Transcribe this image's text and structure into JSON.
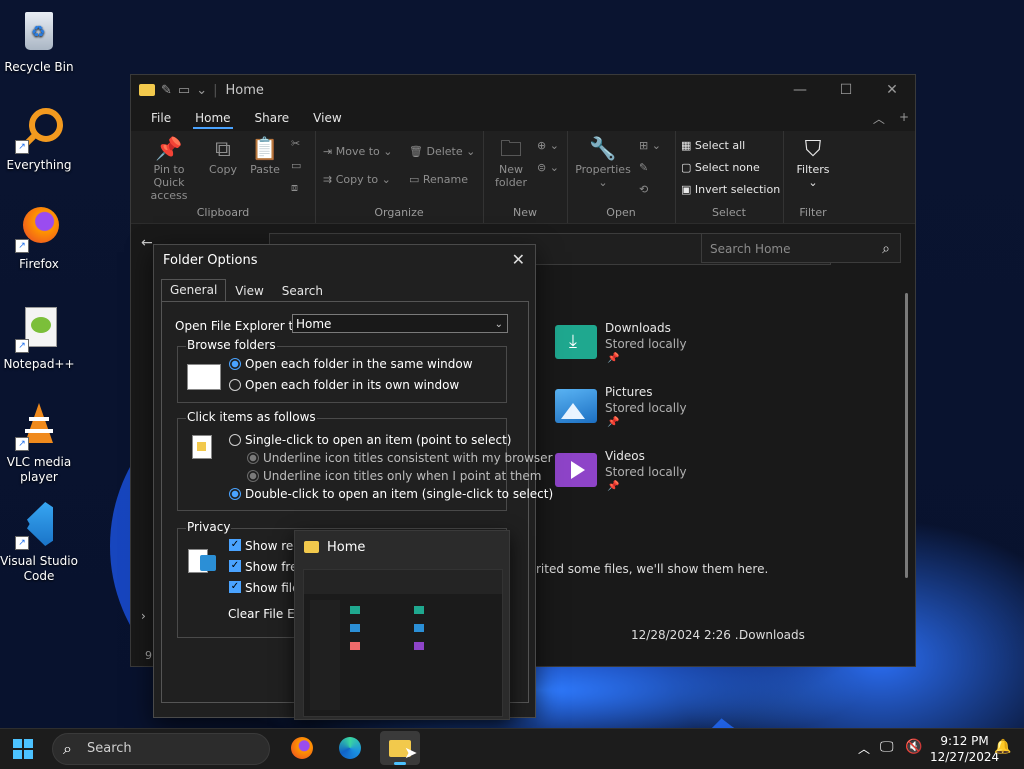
{
  "desktop": {
    "icons": [
      {
        "label": "Recycle Bin",
        "icon": "recycle-bin-icon"
      },
      {
        "label": "Everything",
        "icon": "everything-search-icon"
      },
      {
        "label": "Firefox",
        "icon": "firefox-icon"
      },
      {
        "label": "Notepad++",
        "icon": "notepad-plus-plus-icon"
      },
      {
        "label": "VLC media player",
        "icon": "vlc-icon"
      },
      {
        "label": "Visual Studio Code",
        "icon": "vscode-icon"
      }
    ]
  },
  "explorer": {
    "title": "Home",
    "menu": {
      "file": "File",
      "home": "Home",
      "share": "Share",
      "view": "View"
    },
    "ribbon": {
      "clipboard": {
        "pin": "Pin to Quick access",
        "copy": "Copy",
        "paste": "Paste",
        "group": "Clipboard"
      },
      "organize": {
        "move_to": "Move to",
        "copy_to": "Copy to",
        "delete": "Delete",
        "rename": "Rename",
        "group": "Organize"
      },
      "new": {
        "new_folder": "New folder",
        "group": "New"
      },
      "open": {
        "properties": "Properties",
        "group": "Open"
      },
      "select": {
        "select_all": "Select all",
        "select_none": "Select none",
        "invert": "Invert selection",
        "group": "Select"
      },
      "filter": {
        "filters": "Filters",
        "group": "Filter"
      }
    },
    "search_placeholder": "Search Home",
    "folders": [
      {
        "name": "Downloads",
        "status": "Stored locally",
        "color": "#1fa88f"
      },
      {
        "name": "Pictures",
        "status": "Stored locally",
        "color": "#2b8fd6"
      },
      {
        "name": "Videos",
        "status": "Stored locally",
        "color": "#8e44c8"
      }
    ],
    "favorites_msg": "rited some files, we'll show them here.",
    "recent": {
      "date": "12/28/2024 2:26 ...",
      "location": "Downloads"
    },
    "status_left": "9"
  },
  "dialog": {
    "title": "Folder Options",
    "tabs": {
      "general": "General",
      "view": "View",
      "search": "Search"
    },
    "open_label": "Open File Explorer to:",
    "open_value": "Home",
    "browse": {
      "title": "Browse folders",
      "same": "Open each folder in the same window",
      "own": "Open each folder in its own window"
    },
    "click": {
      "title": "Click items as follows",
      "single": "Single-click to open an item (point to select)",
      "underline_browser": "Underline icon titles consistent with my browser",
      "underline_point": "Underline icon titles only when I point at them",
      "double": "Double-click to open an item (single-click to select)"
    },
    "privacy": {
      "title": "Privacy",
      "recent": "Show rece",
      "frequent": "Show frequ",
      "files": "Show files f",
      "clear": "Clear File Explo"
    }
  },
  "thumbnail": {
    "title": "Home"
  },
  "taskbar": {
    "search": "Search",
    "time": "9:12 PM",
    "date": "12/27/2024"
  }
}
